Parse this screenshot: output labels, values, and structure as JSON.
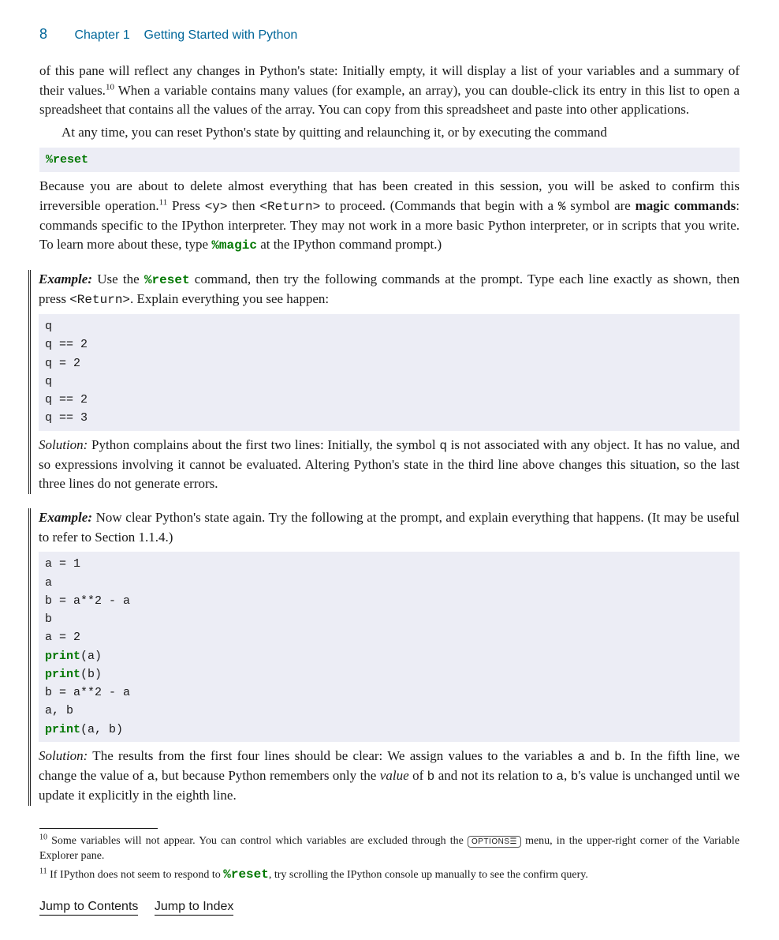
{
  "header": {
    "page_number": "8",
    "chapter": "Chapter 1",
    "title": "Getting Started with Python"
  },
  "body": {
    "p1a": "of this pane will reflect any changes in Python's state: Initially empty, it will display a list of your variables and a summary of their values.",
    "fn10mark": "10",
    "p1b": " When a variable contains many values (for example, an array), you can double-click its entry in this list to open a spreadsheet that contains all the values of the array. You can copy from this spreadsheet and paste into other applications.",
    "p2": "At any time, you can reset Python's state by quitting and relaunching it, or by executing the command",
    "code_reset": "%reset",
    "p3a": "Because you are about to delete almost everything that has been created in this session, you will be asked to confirm this irreversible operation.",
    "fn11mark": "11",
    "p3b": " Press ",
    "p3_y": "<y>",
    "p3c": " then ",
    "p3_return": "<Return>",
    "p3d": " to proceed. (Commands that begin with a ",
    "p3_pct": "%",
    "p3e": " symbol are ",
    "p3_magic": "magic commands",
    "p3f": ": commands specific to the IPython interpreter. They may not work in a more basic Python interpreter, or in scripts that you write. To learn more about these, type ",
    "p3_magiccmd": "%magic",
    "p3g": " at the IPython command prompt.)"
  },
  "example1": {
    "label": "Example:",
    "text_a": "  Use the ",
    "reset": "%reset",
    "text_b": " command, then try the following commands at the prompt. Type each line exactly as shown, then press ",
    "return": "<Return>",
    "text_c": ". Explain everything you see happen:",
    "code": "q\nq == 2\nq = 2\nq\nq == 2\nq == 3",
    "sol_label": "Solution:",
    "sol_a": "  Python complains about the first two lines: Initially, the symbol ",
    "sol_q": "q",
    "sol_b": " is not associated with any object. It has no value, and so expressions involving it cannot be evaluated. Altering Python's state in the third line above changes this situation, so the last three lines do not generate errors."
  },
  "example2": {
    "label": "Example:",
    "text": "  Now clear Python's state again. Try the following at the prompt, and explain everything that happens. (It may be useful to refer to Section 1.1.4.)",
    "sol_label": "Solution:",
    "sol_a": "  The results from the first four lines should be clear: We assign values to the variables ",
    "sol_aa": "a",
    "sol_b": " and ",
    "sol_bb": "b",
    "sol_c": ". In the fifth line, we change the value of ",
    "sol_d": ", but because Python remembers only the ",
    "sol_value": "value",
    "sol_e": " of ",
    "sol_f": " and not its relation to ",
    "sol_g": ", ",
    "sol_h": "'s value is unchanged until we update it explicitly in the eighth line."
  },
  "footnotes": {
    "f10_mark": "10",
    "f10_a": " Some variables will not appear. You can control which variables are excluded through the ",
    "f10_options": "OPTIONS☰",
    "f10_b": " menu, in the upper-right corner of the Variable Explorer pane.",
    "f11_mark": "11",
    "f11_a": " If IPython does not seem to respond to ",
    "f11_reset": "%reset",
    "f11_b": ", try scrolling the IPython console up manually to see the confirm query."
  },
  "nav": {
    "contents": "Jump to Contents",
    "index": "Jump to Index"
  }
}
